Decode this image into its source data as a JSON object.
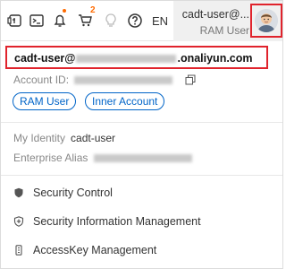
{
  "topbar": {
    "icons": [
      "workbench-icon",
      "terminal-icon",
      "bell-icon",
      "cart-icon",
      "bulb-icon",
      "help-icon"
    ],
    "cart_count": "2",
    "language": "EN",
    "user_display": "cadt-user@...",
    "user_role": "RAM User"
  },
  "account": {
    "email_prefix": "cadt-user@",
    "email_suffix": ".onaliyun.com",
    "id_label": "Account ID:",
    "tags": [
      "RAM User",
      "Inner Account"
    ]
  },
  "identity": {
    "my_identity_label": "My Identity",
    "my_identity_value": "cadt-user",
    "enterprise_alias_label": "Enterprise Alias"
  },
  "menu": [
    {
      "label": "Security Control",
      "icon": "shield-icon"
    },
    {
      "label": "Security Information Management",
      "icon": "shield-plus-icon"
    },
    {
      "label": "AccessKey Management",
      "icon": "key-icon"
    }
  ],
  "colors": {
    "highlight": "#e0232c",
    "accent": "#ff6a00",
    "link": "#0064c8"
  }
}
